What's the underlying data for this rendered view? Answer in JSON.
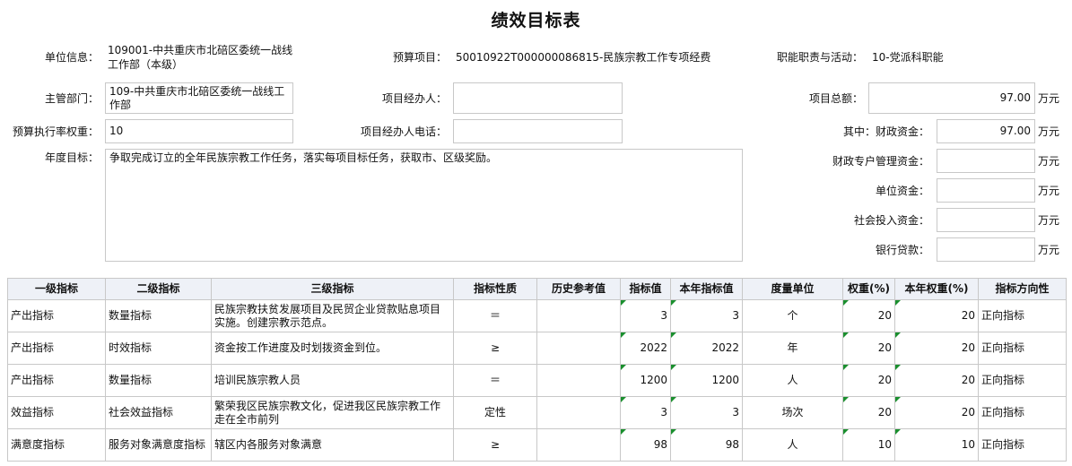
{
  "title": "绩效目标表",
  "info": {
    "unit_label": "单位信息：",
    "unit_value": "109001-中共重庆市北碚区委统一战线工作部（本级）",
    "budget_item_label": "预算项目：",
    "budget_item_value": "50010922T000000086815-民族宗教工作专项经费",
    "duty_label": "职能职责与活动：",
    "duty_value": "10-党派科职能",
    "dept_label": "主管部门：",
    "dept_value": "109-中共重庆市北碚区委统一战线工作部",
    "manager_label": "项目经办人：",
    "manager_value": "",
    "total_label": "项目总额：",
    "total_value": "97.00",
    "weight_label": "预算执行率权重：",
    "weight_value": "10",
    "phone_label": "项目经办人电话：",
    "phone_value": "",
    "fin_label": "其中：财政资金：",
    "fin_value": "97.00",
    "goal_label": "年度目标：",
    "goal_value": "争取完成订立的全年民族宗教工作任务，落实每项目标任务，获取市、区级奖励。",
    "special_label": "财政专户管理资金：",
    "special_value": "",
    "unitfund_label": "单位资金：",
    "unitfund_value": "",
    "social_label": "社会投入资金：",
    "social_value": "",
    "loan_label": "银行贷款：",
    "loan_value": "",
    "unit_wan": "万元"
  },
  "table": {
    "headers": [
      "一级指标",
      "二级指标",
      "三级指标",
      "指标性质",
      "历史参考值",
      "指标值",
      "本年指标值",
      "度量单位",
      "权重(%)",
      "本年权重(%)",
      "指标方向性"
    ],
    "rows": [
      [
        "产出指标",
        "数量指标",
        "民族宗教扶贫发展项目及民贸企业贷款贴息项目实施。创建宗教示范点。",
        "＝",
        "",
        "3",
        "3",
        "个",
        "20",
        "20",
        "正向指标"
      ],
      [
        "产出指标",
        "时效指标",
        "资金按工作进度及时划拨资金到位。",
        "≥",
        "",
        "2022",
        "2022",
        "年",
        "20",
        "20",
        "正向指标"
      ],
      [
        "产出指标",
        "数量指标",
        "培训民族宗教人员",
        "＝",
        "",
        "1200",
        "1200",
        "人",
        "20",
        "20",
        "正向指标"
      ],
      [
        "效益指标",
        "社会效益指标",
        "繁荣我区民族宗教文化，促进我区民族宗教工作走在全市前列",
        "定性",
        "",
        "3",
        "3",
        "场次",
        "20",
        "20",
        "正向指标"
      ],
      [
        "满意度指标",
        "服务对象满意度指标",
        "辖区内各服务对象满意",
        "≥",
        "",
        "98",
        "98",
        "人",
        "10",
        "10",
        "正向指标"
      ]
    ]
  }
}
